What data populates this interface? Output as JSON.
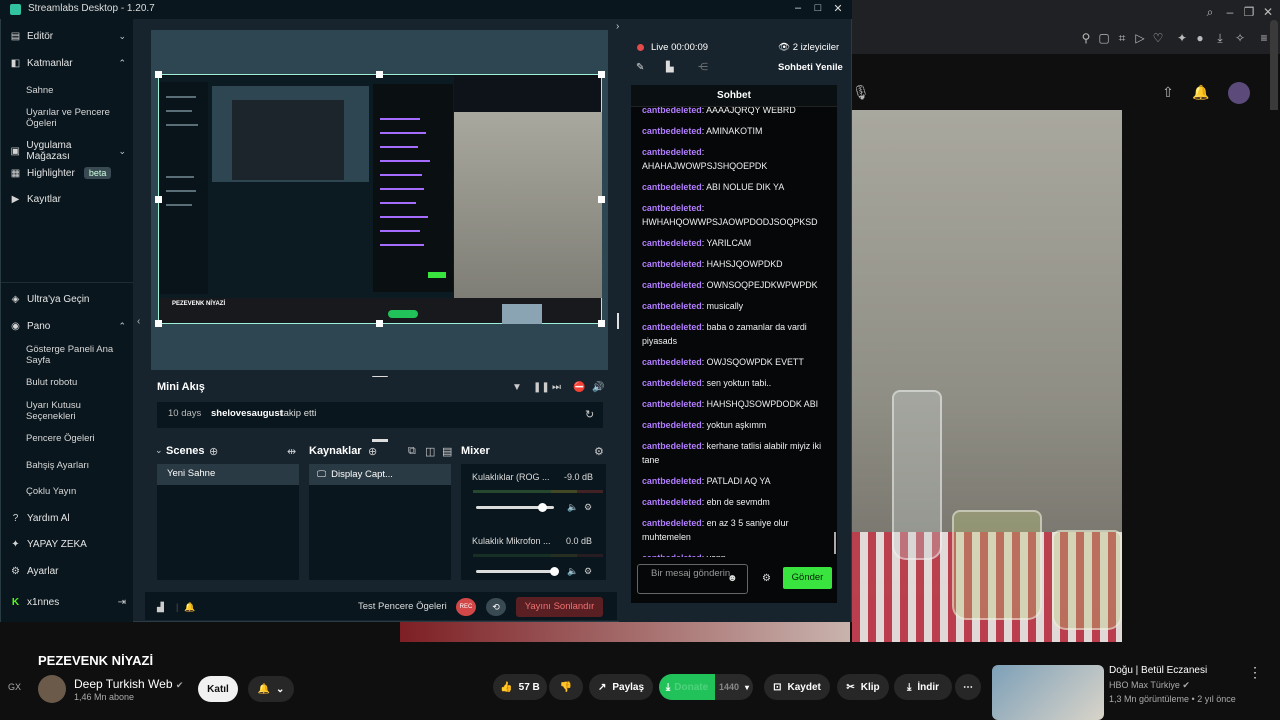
{
  "window": {
    "title": "Streamlabs Desktop - 1.20.7",
    "min": "–",
    "max": "□",
    "close": "✕"
  },
  "sidebar": {
    "items": [
      {
        "label": "Editör",
        "icon": "editor-icon"
      },
      {
        "label": "Katmanlar",
        "icon": "layers-icon"
      },
      {
        "label": "Uygulama Mağazası",
        "icon": "store-icon"
      },
      {
        "label": "Highlighter",
        "icon": "highlighter-icon",
        "badge": "beta"
      },
      {
        "label": "Kayıtlar",
        "icon": "recordings-icon"
      },
      {
        "label": "Ultra'ya Geçin",
        "icon": "ultra-icon"
      },
      {
        "label": "Pano",
        "icon": "dashboard-icon"
      },
      {
        "label": "Yardım Al",
        "icon": "help-icon"
      },
      {
        "label": "YAPAY ZEKA",
        "icon": "ai-icon"
      },
      {
        "label": "Ayarlar",
        "icon": "settings-icon"
      },
      {
        "label": "x1nnes",
        "icon": "kick-icon"
      }
    ],
    "katmanlar_sub": [
      "Sahne",
      "Uyarılar ve Pencere Ögeleri"
    ],
    "pano_sub": [
      "Gösterge Paneli Ana Sayfa",
      "Bulut robotu",
      "Uyarı Kutusu Seçenekleri",
      "Pencere Ögeleri",
      "Bahşiş Ayarları",
      "Çoklu Yayın"
    ]
  },
  "preview": {
    "nested_title": "PEZEVENK NİYAZİ"
  },
  "mini_feed": {
    "title": "Mini Akış",
    "time": "10 days",
    "user": "shelovesaugust",
    "action": "takip etti"
  },
  "scenes": {
    "title": "Scenes",
    "items": [
      "Yeni Sahne"
    ]
  },
  "sources": {
    "title": "Kaynaklar",
    "items": [
      "Display Capt..."
    ]
  },
  "mixer": {
    "title": "Mixer",
    "channels": [
      {
        "name": "Kulaklıklar (ROG ...",
        "db": "-9.0 dB",
        "level": 0.85
      },
      {
        "name": "Kulaklık Mikrofon ...",
        "db": "0.0 dB",
        "level": 1.0
      }
    ]
  },
  "footer": {
    "test_label": "Test Pencere Ögeleri",
    "rec": "REC",
    "end_stream": "Yayını Sonlandır"
  },
  "live": {
    "status": "Live",
    "time": "00:00:09",
    "viewers": "2 izleyiciler",
    "refresh_chat": "Sohbeti Yenile"
  },
  "chat": {
    "title": "Sohbet",
    "messages": [
      {
        "user": "cantbedeleted",
        "text": "AAAAJQRQY WEBRD"
      },
      {
        "user": "cantbedeleted",
        "text": "AMINAKOTIM"
      },
      {
        "user": "cantbedeleted",
        "text": "AHAHAJWOWPSJSHQOEPDK"
      },
      {
        "user": "cantbedeleted",
        "text": "ABI NOLUE DIK YA"
      },
      {
        "user": "cantbedeleted",
        "text": "HWHAHQOWWPSJAOWPDODJSOQPKSD"
      },
      {
        "user": "cantbedeleted",
        "text": "YARILCAM"
      },
      {
        "user": "cantbedeleted",
        "text": "HAHSJQOWPDKD"
      },
      {
        "user": "cantbedeleted",
        "text": "OWNSOQPEJDKWPWPDK"
      },
      {
        "user": "cantbedeleted",
        "text": "musically"
      },
      {
        "user": "cantbedeleted",
        "text": "baba o zamanlar da vardi piyasads"
      },
      {
        "user": "cantbedeleted",
        "text": "OWJSQOWPDK EVETT"
      },
      {
        "user": "cantbedeleted",
        "text": "sen yoktun tabi.."
      },
      {
        "user": "cantbedeleted",
        "text": "HAHSHQJSOWPDODK ABI"
      },
      {
        "user": "cantbedeleted",
        "text": "yoktun aşkımm"
      },
      {
        "user": "cantbedeleted",
        "text": "kerhane tatlisi alabilr miyiz iki tane"
      },
      {
        "user": "cantbedeleted",
        "text": "PATLADI AQ YA"
      },
      {
        "user": "cantbedeleted",
        "text": "ebn de sevmdm"
      },
      {
        "user": "cantbedeleted",
        "text": "en az 3 5 saniye olur muhtemelen"
      },
      {
        "user": "cantbedeleted",
        "text": "yapp"
      }
    ],
    "input_placeholder": "Bir mesaj gönderin",
    "send": "Gönder"
  },
  "youtube": {
    "video_title": "PEZEVENK NİYAZİ",
    "gx": "GX",
    "channel": "Deep Turkish Web",
    "subs": "1,46 Mn abone",
    "join": "Katıl",
    "likes": "57 B",
    "share": "Paylaş",
    "ext_label": "Donate",
    "ext_count": "1440",
    "save": "Kaydet",
    "clip": "Klip",
    "download": "İndir",
    "rec_title": "Doğu | Betül Eczanesi",
    "rec_channel": "HBO Max Türkiye",
    "rec_meta": "1,3 Mn görüntüleme • 2 yıl önce"
  }
}
